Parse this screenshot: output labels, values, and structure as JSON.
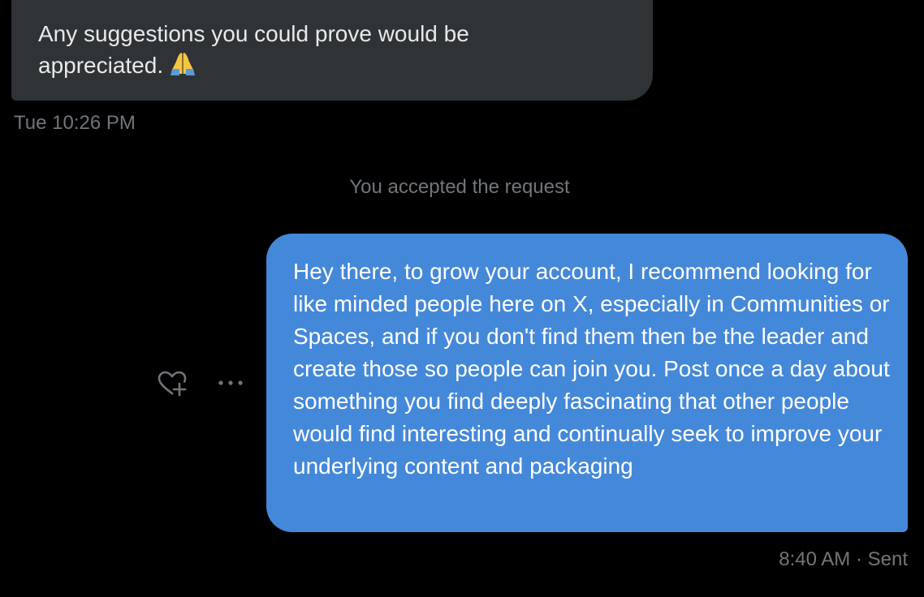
{
  "incoming_message": {
    "text": "Any suggestions you could prove would be\nappreciated.",
    "emoji": "folded-hands-emoji",
    "timestamp": "Tue 10:26 PM"
  },
  "system_message": {
    "text": "You accepted the request"
  },
  "outgoing_message": {
    "text": "Hey there, to grow your account, I recommend looking for like minded people here on X, especially in Communities or Spaces, and if you don't find them then be the leader and create those so people can join you. Post once a day about something you find deeply fascinating that other people would find interesting and continually seek to improve your underlying content and packaging",
    "timestamp": "8:40 AM",
    "separator": "·",
    "status": "Sent"
  },
  "message_actions": {
    "react_icon": "heart-plus-icon",
    "more_icon": "more-horizontal-icon"
  },
  "colors": {
    "background": "#000000",
    "incoming_bubble": "#2f3336",
    "outgoing_bubble": "#4488d9",
    "secondary_text": "#71767b",
    "primary_text": "#e7e9ea"
  }
}
